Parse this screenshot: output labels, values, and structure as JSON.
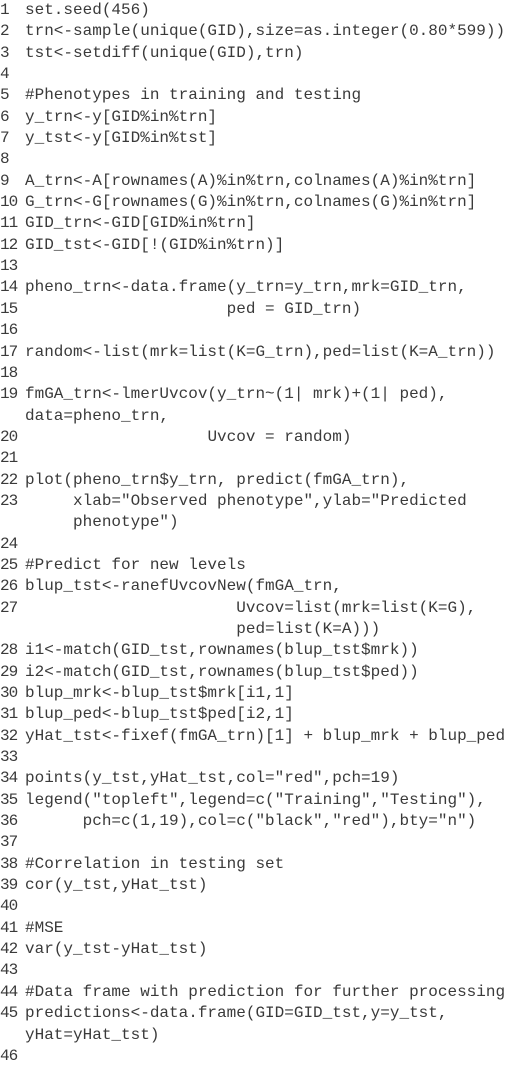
{
  "code": {
    "language": "R",
    "lines": [
      {
        "n": "1",
        "text": "set.seed(456)"
      },
      {
        "n": "2",
        "text": "trn<-sample(unique(GID),size=as.integer(0.80*599))"
      },
      {
        "n": "3",
        "text": "tst<-setdiff(unique(GID),trn)"
      },
      {
        "n": "4",
        "text": ""
      },
      {
        "n": "5",
        "text": "#Phenotypes in training and testing"
      },
      {
        "n": "6",
        "text": "y_trn<-y[GID%in%trn]"
      },
      {
        "n": "7",
        "text": "y_tst<-y[GID%in%tst]"
      },
      {
        "n": "8",
        "text": ""
      },
      {
        "n": "9",
        "text": "A_trn<-A[rownames(A)%in%trn,colnames(A)%in%trn]"
      },
      {
        "n": "10",
        "text": "G_trn<-G[rownames(G)%in%trn,colnames(G)%in%trn]"
      },
      {
        "n": "11",
        "text": "GID_trn<-GID[GID%in%trn]"
      },
      {
        "n": "12",
        "text": "GID_tst<-GID[!(GID%in%trn)]"
      },
      {
        "n": "13",
        "text": ""
      },
      {
        "n": "14",
        "text": "pheno_trn<-data.frame(y_trn=y_trn,mrk=GID_trn,"
      },
      {
        "n": "15",
        "text": "                     ped = GID_trn)"
      },
      {
        "n": "16",
        "text": ""
      },
      {
        "n": "17",
        "text": "random<-list(mrk=list(K=G_trn),ped=list(K=A_trn))"
      },
      {
        "n": "18",
        "text": ""
      },
      {
        "n": "19",
        "text": "fmGA_trn<-lmerUvcov(y_trn~(1| mrk)+(1| ped),\ndata=pheno_trn,"
      },
      {
        "n": "20",
        "text": "                   Uvcov = random)"
      },
      {
        "n": "21",
        "text": ""
      },
      {
        "n": "22",
        "text": "plot(pheno_trn$y_trn, predict(fmGA_trn),"
      },
      {
        "n": "23",
        "text": "     xlab=\"Observed phenotype\",ylab=\"Predicted\n     phenotype\")"
      },
      {
        "n": "24",
        "text": ""
      },
      {
        "n": "25",
        "text": "#Predict for new levels"
      },
      {
        "n": "26",
        "text": "blup_tst<-ranefUvcovNew(fmGA_trn,"
      },
      {
        "n": "27",
        "text": "                      Uvcov=list(mrk=list(K=G),\n                      ped=list(K=A)))"
      },
      {
        "n": "28",
        "text": "i1<-match(GID_tst,rownames(blup_tst$mrk))"
      },
      {
        "n": "29",
        "text": "i2<-match(GID_tst,rownames(blup_tst$ped))"
      },
      {
        "n": "30",
        "text": "blup_mrk<-blup_tst$mrk[i1,1]"
      },
      {
        "n": "31",
        "text": "blup_ped<-blup_tst$ped[i2,1]"
      },
      {
        "n": "32",
        "text": "yHat_tst<-fixef(fmGA_trn)[1] + blup_mrk + blup_ped"
      },
      {
        "n": "33",
        "text": ""
      },
      {
        "n": "34",
        "text": "points(y_tst,yHat_tst,col=\"red\",pch=19)"
      },
      {
        "n": "35",
        "text": "legend(\"topleft\",legend=c(\"Training\",\"Testing\"),"
      },
      {
        "n": "36",
        "text": "      pch=c(1,19),col=c(\"black\",\"red\"),bty=\"n\")"
      },
      {
        "n": "37",
        "text": ""
      },
      {
        "n": "38",
        "text": "#Correlation in testing set"
      },
      {
        "n": "39",
        "text": "cor(y_tst,yHat_tst)"
      },
      {
        "n": "40",
        "text": ""
      },
      {
        "n": "41",
        "text": "#MSE"
      },
      {
        "n": "42",
        "text": "var(y_tst-yHat_tst)"
      },
      {
        "n": "43",
        "text": ""
      },
      {
        "n": "44",
        "text": "#Data frame with prediction for further processing"
      },
      {
        "n": "45",
        "text": "predictions<-data.frame(GID=GID_tst,y=y_tst,\nyHat=yHat_tst)"
      },
      {
        "n": "46",
        "text": ""
      }
    ]
  }
}
